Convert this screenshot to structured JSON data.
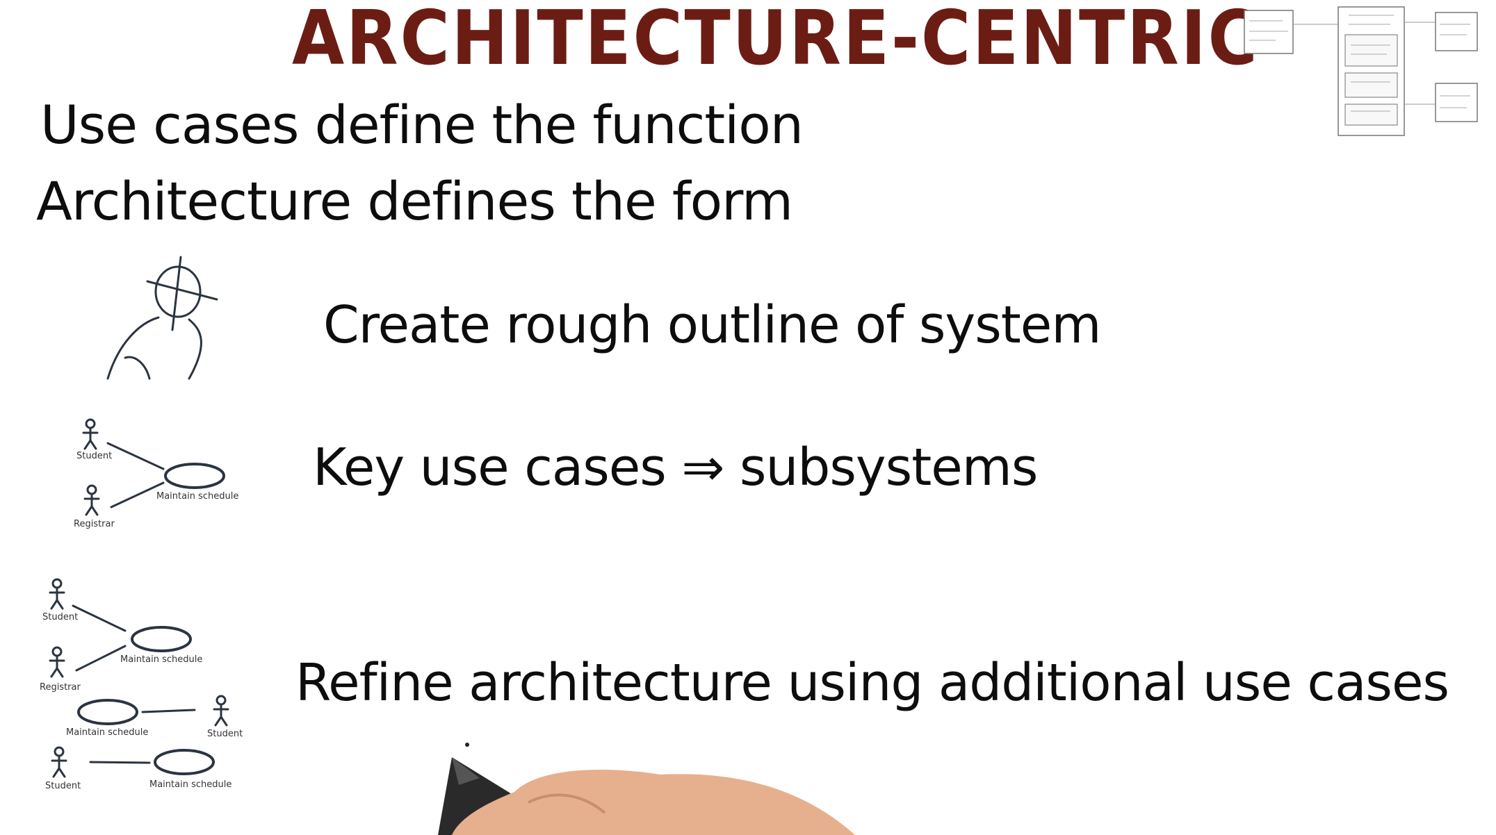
{
  "title": "ARCHITECTURE-CENTRIC",
  "lines": {
    "use_cases": "Use cases define  the function",
    "architecture": "Architecture defines the form"
  },
  "steps": {
    "outline": "Create rough outline of system",
    "key": "Key use cases ⇒ subsystems",
    "refine": "Refine architecture using additional use cases"
  },
  "diagram_labels": {
    "student": "Student",
    "registrar": "Registrar",
    "maintain_schedule": "Maintain schedule"
  },
  "colors": {
    "title": "#6b1d14",
    "ink": "#0d0d0d",
    "diagram_ink": "#2b3440",
    "hand_skin": "#e6b08e"
  },
  "icons": [
    "person-sketch-icon",
    "pen-icon"
  ]
}
